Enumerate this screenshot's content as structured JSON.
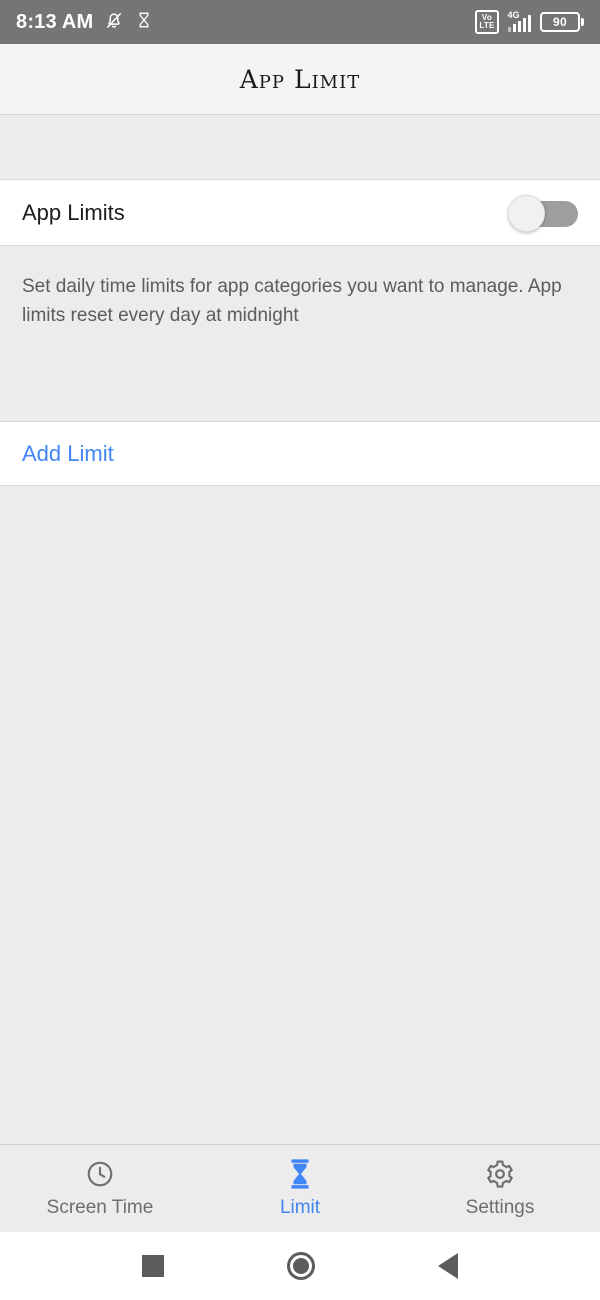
{
  "status_bar": {
    "time": "8:13 AM",
    "icons": [
      "notifications-off-icon",
      "hourglass-icon"
    ],
    "volte_line1": "Vo",
    "volte_line2": "LTE",
    "network_type": "4G",
    "signal_bars": 4,
    "battery_level": "90"
  },
  "app_bar": {
    "title": "App Limit"
  },
  "main": {
    "app_limits_row": {
      "label": "App Limits",
      "toggle_state": "off"
    },
    "description": "Set daily time limits for app categories you want to manage. App limits reset every day at midnight",
    "add_limit": {
      "label": "Add Limit"
    }
  },
  "tab_bar": {
    "tabs": [
      {
        "label": "Screen Time",
        "icon": "clock-icon",
        "active": false
      },
      {
        "label": "Limit",
        "icon": "hourglass-icon",
        "active": true
      },
      {
        "label": "Settings",
        "icon": "gear-icon",
        "active": false
      }
    ]
  },
  "nav_bar": {
    "recents": "square-recents-icon",
    "home": "circle-home-icon",
    "back": "triangle-back-icon"
  },
  "colors": {
    "accent": "#4285f4",
    "status_bar_bg": "#757575",
    "page_bg": "#ececec",
    "card_bg": "#ffffff",
    "muted_text": "#5c5c5c"
  }
}
